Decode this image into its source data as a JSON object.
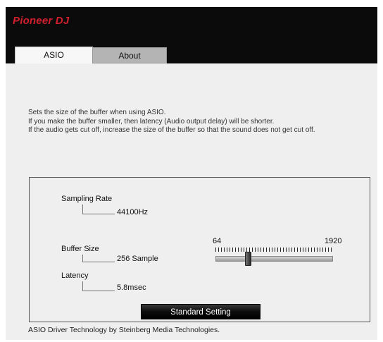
{
  "brand": {
    "logo_text": "Pioneer DJ",
    "logo_color": "#d0202d"
  },
  "tabs": [
    {
      "label": "ASIO",
      "active": true
    },
    {
      "label": "About",
      "active": false
    }
  ],
  "description": [
    "Sets the size of the buffer when using ASIO.",
    "If you make the buffer smaller, then latency (Audio output delay) will be shorter.",
    "If the audio gets cut off, increase the size of the buffer so that the sound does not get cut off."
  ],
  "settings": {
    "sampling_rate": {
      "label": "Sampling Rate",
      "value": "44100Hz"
    },
    "buffer_size": {
      "label": "Buffer Size",
      "value": "256 Sample"
    },
    "latency": {
      "label": "Latency",
      "value": "5.8msec"
    }
  },
  "slider": {
    "min_label": "64",
    "max_label": "1920",
    "min": 64,
    "max": 1920,
    "value": 256
  },
  "standard_button": {
    "label": "Standard Setting"
  },
  "footer": {
    "text": "ASIO Driver Technology by Steinberg Media Technologies."
  }
}
